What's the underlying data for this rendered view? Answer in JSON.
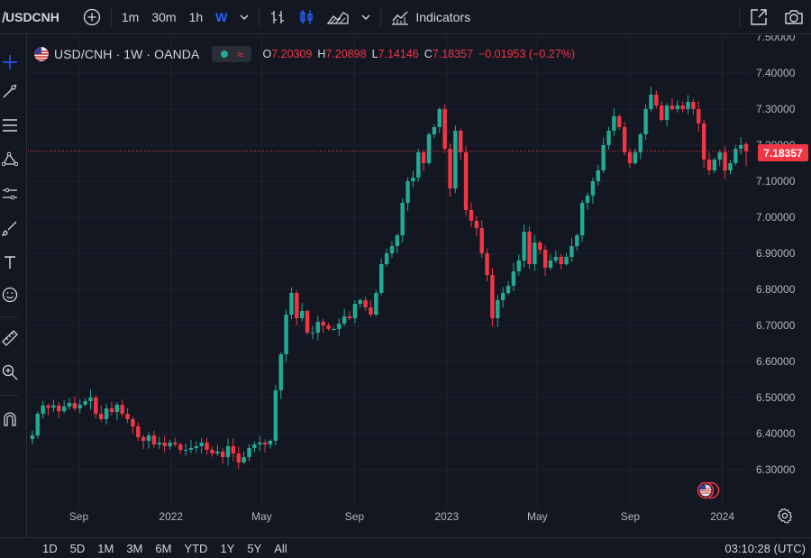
{
  "toolbar": {
    "symbol": "USDCNH",
    "intervals": [
      "1m",
      "30m",
      "1h",
      "W"
    ],
    "active_interval": "W",
    "indicators_label": "Indicators"
  },
  "legend": {
    "title": "USD/CNH · 1W · OANDA",
    "open_label": "O",
    "open": "7.20309",
    "high_label": "H",
    "high": "7.20898",
    "low_label": "L",
    "low": "7.14146",
    "close_label": "C",
    "close": "7.18357",
    "change": "−0.01953 (−0.27%)"
  },
  "current_price": "7.18357",
  "bottombar": {
    "ranges": [
      "1D",
      "5D",
      "1M",
      "3M",
      "6M",
      "YTD",
      "1Y",
      "5Y",
      "All"
    ],
    "clock": "03:10:28 (UTC)"
  },
  "colors": {
    "up": "#22ab94",
    "down": "#f23645",
    "background": "#131722",
    "grid": "#1e222d",
    "text": "#d1d4dc",
    "accent": "#2962ff"
  },
  "icons": {
    "top": [
      "add-symbol-icon",
      "bars-icon",
      "candles-icon",
      "area-icon",
      "chevron-down-icon",
      "indicators-icon",
      "fullscreen-icon",
      "camera-icon"
    ],
    "left": [
      "crosshair-icon",
      "trendline-icon",
      "fib-icon",
      "pattern-icon",
      "prediction-icon",
      "brush-icon",
      "text-icon",
      "emoji-icon",
      "ruler-icon",
      "zoom-icon",
      "magnet-icon"
    ]
  },
  "chart_data": {
    "type": "candlestick",
    "y_axis_labels": [
      "7.50000",
      "7.40000",
      "7.30000",
      "7.20000",
      "7.10000",
      "7.00000",
      "6.90000",
      "6.80000",
      "6.70000",
      "6.60000",
      "6.50000",
      "6.40000",
      "6.30000"
    ],
    "ylim": [
      6.21,
      7.5
    ],
    "x_axis_labels": [
      "Sep",
      "2022",
      "May",
      "Sep",
      "2023",
      "May",
      "Sep",
      "2024"
    ],
    "x_axis_label_dates": [
      "2021-09-01",
      "2022-01-01",
      "2022-05-01",
      "2022-09-01",
      "2023-01-01",
      "2023-05-01",
      "2023-09-01",
      "2024-01-01"
    ],
    "x_range": [
      "2021-06-28",
      "2024-02-05"
    ],
    "grid": true,
    "weekly_closes": [
      6.395,
      6.455,
      6.478,
      6.472,
      6.478,
      6.462,
      6.475,
      6.485,
      6.47,
      6.48,
      6.49,
      6.5,
      6.455,
      6.44,
      6.47,
      6.46,
      6.48,
      6.455,
      6.44,
      6.42,
      6.39,
      6.38,
      6.395,
      6.37,
      6.375,
      6.365,
      6.375,
      6.37,
      6.355,
      6.355,
      6.36,
      6.365,
      6.375,
      6.355,
      6.345,
      6.35,
      6.335,
      6.365,
      6.345,
      6.32,
      6.335,
      6.36,
      6.37,
      6.375,
      6.37,
      6.38,
      6.52,
      6.62,
      6.73,
      6.79,
      6.72,
      6.74,
      6.68,
      6.68,
      6.71,
      6.7,
      6.69,
      6.69,
      6.705,
      6.725,
      6.72,
      6.76,
      6.77,
      6.75,
      6.73,
      6.79,
      6.87,
      6.9,
      6.92,
      6.95,
      7.04,
      7.1,
      7.11,
      7.18,
      7.15,
      7.23,
      7.25,
      7.3,
      7.19,
      7.08,
      7.24,
      7.18,
      7.02,
      6.99,
      6.97,
      6.9,
      6.84,
      6.72,
      6.77,
      6.79,
      6.81,
      6.85,
      6.88,
      6.96,
      6.87,
      6.93,
      6.91,
      6.86,
      6.88,
      6.89,
      6.87,
      6.89,
      6.92,
      6.95,
      7.04,
      7.06,
      7.1,
      7.13,
      7.2,
      7.24,
      7.28,
      7.25,
      7.18,
      7.15,
      7.18,
      7.23,
      7.3,
      7.34,
      7.31,
      7.27,
      7.31,
      7.3,
      7.31,
      7.3,
      7.32,
      7.3,
      7.26,
      7.16,
      7.13,
      7.16,
      7.18,
      7.13,
      7.15,
      7.19,
      7.2,
      7.184
    ],
    "last_week": {
      "open": 7.20309,
      "high": 7.20898,
      "low": 7.14146,
      "close": 7.18357
    }
  }
}
